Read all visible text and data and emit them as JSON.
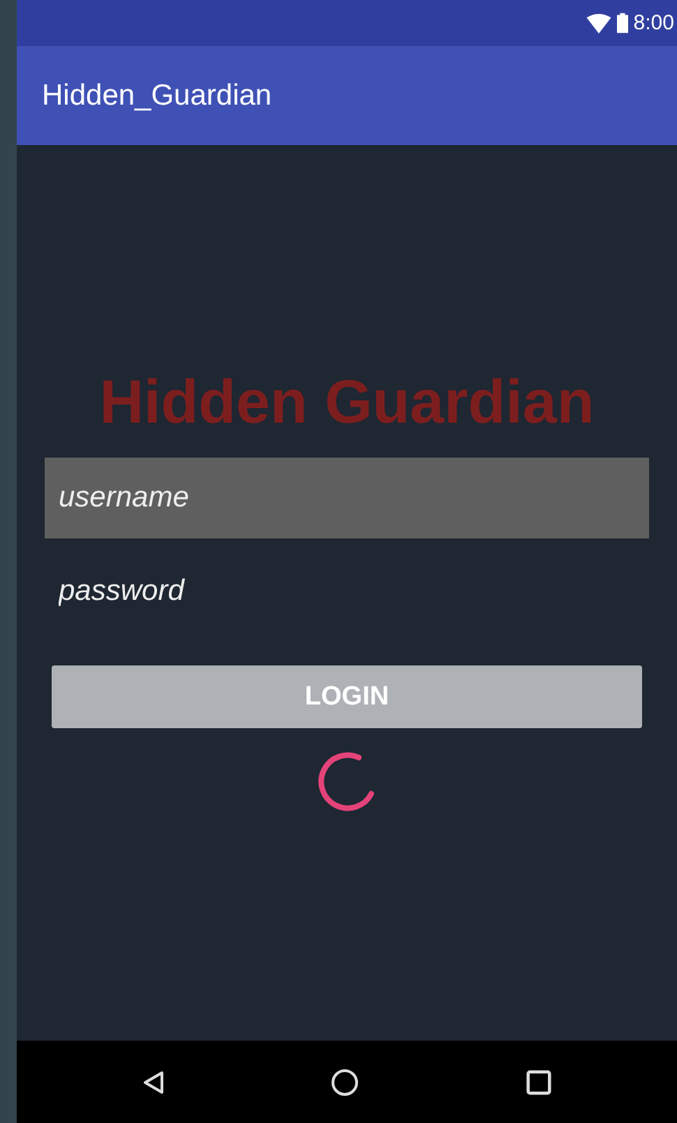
{
  "status_bar": {
    "time": "8:00"
  },
  "app_bar": {
    "title": "Hidden_Guardian"
  },
  "heading": "Hidden Guardian",
  "fields": [
    {
      "placeholder": "username",
      "focused": true
    },
    {
      "placeholder": "password",
      "focused": false
    }
  ],
  "login_button": {
    "label": "LOGIN",
    "disabled": true
  },
  "loading": true
}
